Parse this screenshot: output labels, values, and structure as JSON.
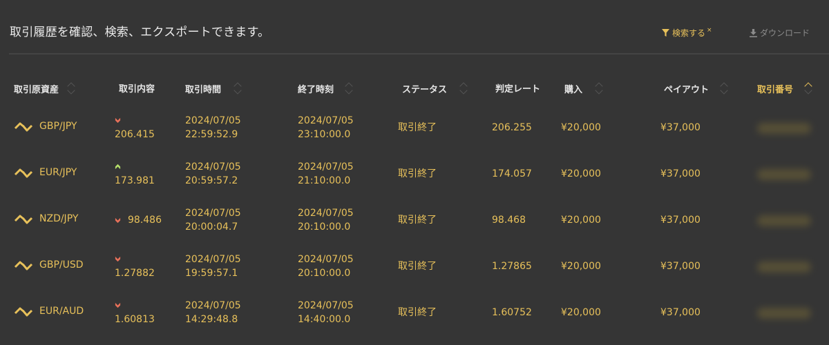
{
  "header": {
    "description": "取引履歴を確認、検索、エクスポートできます。",
    "search_label": "検索する",
    "search_clear": "×",
    "download_label": "ダウンロード"
  },
  "columns": {
    "asset": "取引原資産",
    "content": "取引内容",
    "time": "取引時間",
    "end": "終了時刻",
    "status": "ステータス",
    "rate": "判定レート",
    "purchase": "購入",
    "payout": "ペイアウト",
    "number": "取引番号"
  },
  "colors": {
    "accent": "#e8c15a",
    "down": "#e8715a",
    "up": "#b6e06a",
    "background": "#353535"
  },
  "rows": [
    {
      "asset": "GBP/JPY",
      "direction": "down",
      "price": "206.415",
      "time_date": "2024/07/05",
      "time_clock": "22:59:52.9",
      "end_date": "2024/07/05",
      "end_clock": "23:10:00.0",
      "status": "取引終了",
      "rate": "206.255",
      "purchase": "¥20,000",
      "payout": "¥37,000"
    },
    {
      "asset": "EUR/JPY",
      "direction": "up",
      "price": "173.981",
      "time_date": "2024/07/05",
      "time_clock": "20:59:57.2",
      "end_date": "2024/07/05",
      "end_clock": "21:10:00.0",
      "status": "取引終了",
      "rate": "174.057",
      "purchase": "¥20,000",
      "payout": "¥37,000"
    },
    {
      "asset": "NZD/JPY",
      "direction": "down",
      "price": "98.486",
      "time_date": "2024/07/05",
      "time_clock": "20:00:04.7",
      "end_date": "2024/07/05",
      "end_clock": "20:10:00.0",
      "status": "取引終了",
      "rate": "98.468",
      "purchase": "¥20,000",
      "payout": "¥37,000"
    },
    {
      "asset": "GBP/USD",
      "direction": "down",
      "price": "1.27882",
      "time_date": "2024/07/05",
      "time_clock": "19:59:57.1",
      "end_date": "2024/07/05",
      "end_clock": "20:10:00.0",
      "status": "取引終了",
      "rate": "1.27865",
      "purchase": "¥20,000",
      "payout": "¥37,000"
    },
    {
      "asset": "EUR/AUD",
      "direction": "down",
      "price": "1.60813",
      "time_date": "2024/07/05",
      "time_clock": "14:29:48.8",
      "end_date": "2024/07/05",
      "end_clock": "14:40:00.0",
      "status": "取引終了",
      "rate": "1.60752",
      "purchase": "¥20,000",
      "payout": "¥37,000"
    }
  ]
}
